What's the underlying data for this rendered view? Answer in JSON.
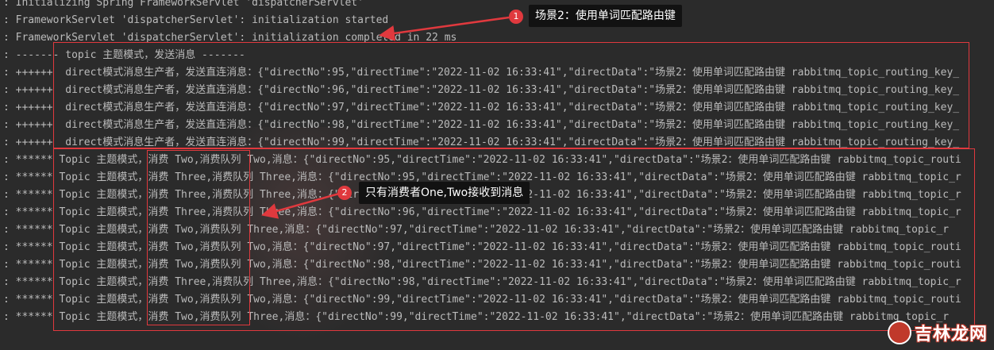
{
  "console": {
    "lines": [
      ": Initializing Spring FrameworkServlet 'dispatcherServlet'",
      ": FrameworkServlet 'dispatcherServlet': initialization started",
      ": FrameworkServlet 'dispatcherServlet': initialization completed in 22 ms",
      ": ------- topic 主题模式，发送消息 -------",
      ": ++++++  direct模式消息生产者，发送直连消息：{\"directNo\":95,\"directTime\":\"2022-11-02 16:33:41\",\"directData\":\"场景2：使用单词匹配路由键 rabbitmq_topic_routing_key_",
      ": ++++++  direct模式消息生产者，发送直连消息：{\"directNo\":96,\"directTime\":\"2022-11-02 16:33:41\",\"directData\":\"场景2：使用单词匹配路由键 rabbitmq_topic_routing_key_",
      ": ++++++  direct模式消息生产者，发送直连消息：{\"directNo\":97,\"directTime\":\"2022-11-02 16:33:41\",\"directData\":\"场景2：使用单词匹配路由键 rabbitmq_topic_routing_key_",
      ": ++++++  direct模式消息生产者，发送直连消息：{\"directNo\":98,\"directTime\":\"2022-11-02 16:33:41\",\"directData\":\"场景2：使用单词匹配路由键 rabbitmq_topic_routing_key_",
      ": ++++++  direct模式消息生产者，发送直连消息：{\"directNo\":99,\"directTime\":\"2022-11-02 16:33:41\",\"directData\":\"场景2：使用单词匹配路由键 rabbitmq_topic_routing_key_",
      ": ****** Topic 主题模式，消费 Two,消费队列 Two,消息：{\"directNo\":95,\"directTime\":\"2022-11-02 16:33:41\",\"directData\":\"场景2：使用单词匹配路由键 rabbitmq_topic_routi",
      ": ****** Topic 主题模式，消费 Three,消费队列 Three,消息：{\"directNo\":95,\"directTime\":\"2022-11-02 16:33:41\",\"directData\":\"场景2：使用单词匹配路由键 rabbitmq_topic_r",
      ": ****** Topic 主题模式，消费 Three,消费队列 Three,消息：{\"directNo\":96,\"directTime\":\"2022-11-02 16:33:41\",\"directData\":\"场景2：使用单词匹配路由键 rabbitmq_topic_r",
      ": ****** Topic 主题模式，消费 Three,消费队列 Three,消息：{\"directNo\":96,\"directTime\":\"2022-11-02 16:33:41\",\"directData\":\"场景2：使用单词匹配路由键 rabbitmq_topic_r",
      ": ****** Topic 主题模式，消费 Two,消费队列 Three,消息：{\"directNo\":97,\"directTime\":\"2022-11-02 16:33:41\",\"directData\":\"场景2：使用单词匹配路由键 rabbitmq_topic_r",
      ": ****** Topic 主题模式，消费 Two,消费队列 Two,消息：{\"directNo\":97,\"directTime\":\"2022-11-02 16:33:41\",\"directData\":\"场景2：使用单词匹配路由键 rabbitmq_topic_routi",
      ": ****** Topic 主题模式，消费 Two,消费队列 Two,消息：{\"directNo\":98,\"directTime\":\"2022-11-02 16:33:41\",\"directData\":\"场景2：使用单词匹配路由键 rabbitmq_topic_routi",
      ": ****** Topic 主题模式，消费 Three,消费队列 Three,消息：{\"directNo\":98,\"directTime\":\"2022-11-02 16:33:41\",\"directData\":\"场景2：使用单词匹配路由键 rabbitmq_topic_r",
      ": ****** Topic 主题模式，消费 Two,消费队列 Two,消息：{\"directNo\":99,\"directTime\":\"2022-11-02 16:33:41\",\"directData\":\"场景2：使用单词匹配路由键 rabbitmq_topic_routi",
      ": ****** Topic 主题模式，消费 Two,消费队列 Three,消息：{\"directNo\":99,\"directTime\":\"2022-11-02 16:33:41\",\"directData\":\"场景2：使用单词匹配路由键 rabbitmq_topic_r"
    ]
  },
  "annotations": {
    "callout1": {
      "number": "1",
      "text": "场景2：使用单词匹配路由键"
    },
    "callout2": {
      "number": "2",
      "text": "只有消费者One,Two接收到消息"
    },
    "highlight_color": "#e0393e"
  },
  "watermark": {
    "text": "吉林龙网"
  },
  "colors": {
    "background": "#2b2b2b",
    "text": "#bbbbbb",
    "callout_bg": "#121212"
  }
}
